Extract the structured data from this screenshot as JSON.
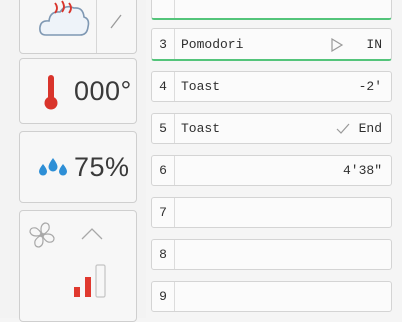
{
  "controls": {
    "temperature": "000°",
    "humidity": "75%",
    "fan_level": 0.66
  },
  "program_rows": [
    {
      "num": "3",
      "name": "Pomodori",
      "value": "IN",
      "state": "play"
    },
    {
      "num": "4",
      "name": "Toast",
      "value": "-2'",
      "state": ""
    },
    {
      "num": "5",
      "name": "Toast",
      "value": "End",
      "state": "done"
    },
    {
      "num": "6",
      "name": "",
      "value": "4'38\"",
      "state": ""
    },
    {
      "num": "7",
      "name": "",
      "value": "",
      "state": ""
    },
    {
      "num": "8",
      "name": "",
      "value": "",
      "state": ""
    },
    {
      "num": "9",
      "name": "",
      "value": "",
      "state": ""
    }
  ],
  "colors": {
    "accent_green": "#53c47a",
    "thermometer_red": "#d9342b",
    "water_blue": "#2e8fd6",
    "bar_red": "#e0392f"
  }
}
